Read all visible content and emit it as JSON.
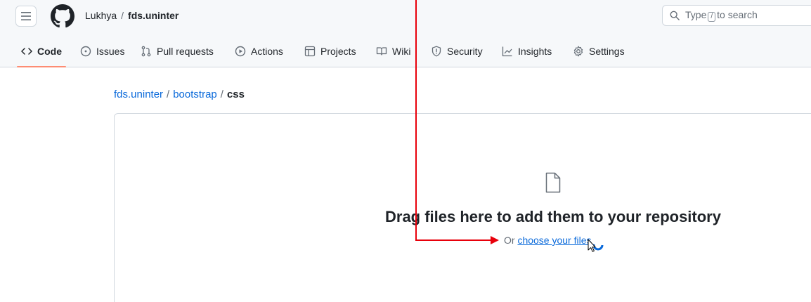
{
  "topbar": {
    "owner": "Lukhya",
    "separator": "/",
    "repo": "fds.uninter",
    "search": {
      "prefix": "Type",
      "key": "/",
      "suffix": "to search"
    }
  },
  "tabs": [
    {
      "label": "Code",
      "icon": "code-icon",
      "active": true
    },
    {
      "label": "Issues",
      "icon": "issue-icon"
    },
    {
      "label": "Pull requests",
      "icon": "pull-request-icon"
    },
    {
      "label": "Actions",
      "icon": "play-icon"
    },
    {
      "label": "Projects",
      "icon": "table-icon"
    },
    {
      "label": "Wiki",
      "icon": "book-icon"
    },
    {
      "label": "Security",
      "icon": "shield-icon"
    },
    {
      "label": "Insights",
      "icon": "graph-icon"
    },
    {
      "label": "Settings",
      "icon": "gear-icon"
    }
  ],
  "path": {
    "root": "fds.uninter",
    "separator": "/",
    "folder": "bootstrap",
    "current": "css"
  },
  "dropzone": {
    "title": "Drag files here to add them to your repository",
    "prefix": "Or",
    "link": "choose your files"
  },
  "colors": {
    "link": "#0969da",
    "annotation": "#e8000b",
    "active_tab_underline": "#fd8c73"
  }
}
